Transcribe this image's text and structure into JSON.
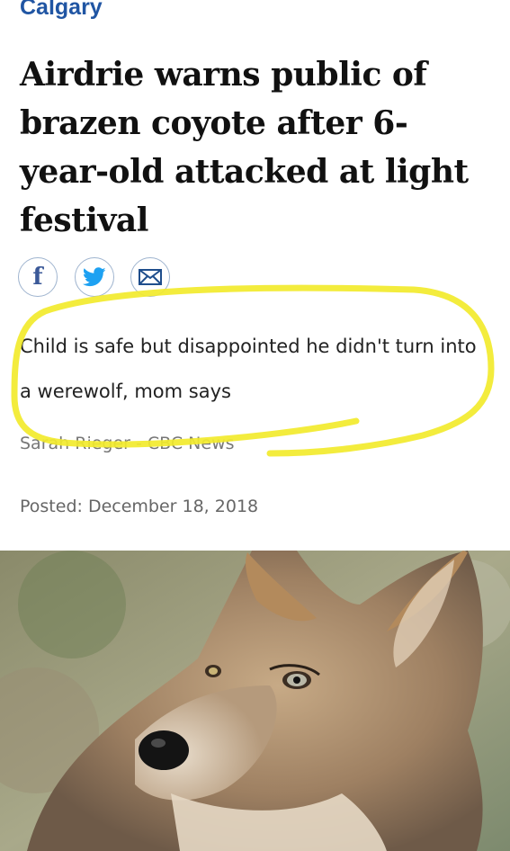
{
  "section": "Calgary",
  "headline": "Airdrie warns public of brazen coyote after 6-year-old attacked at light festival",
  "share": {
    "icons": [
      "facebook-icon",
      "twitter-icon",
      "email-icon"
    ],
    "facebook_glyph": "f"
  },
  "subheadline": "Child is safe but disappointed he didn't turn into a werewolf, mom says",
  "byline": "Sarah Rieger - CBC News",
  "posted": "Posted: December 18, 2018",
  "colors": {
    "section": "#2055a3",
    "facebook": "#3b5998",
    "twitter": "#1da1f2",
    "highlight": "#f2ea2c"
  }
}
